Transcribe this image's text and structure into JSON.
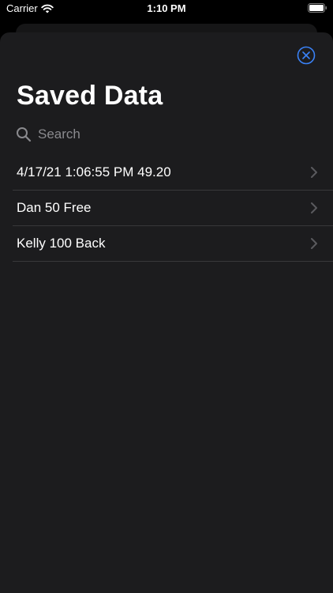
{
  "status_bar": {
    "carrier": "Carrier",
    "time": "1:10 PM"
  },
  "sheet": {
    "title": "Saved Data",
    "close_icon": "close-circle-icon",
    "accent_color": "#3a82f7"
  },
  "search": {
    "placeholder": "Search",
    "value": ""
  },
  "saved_items": [
    {
      "label": "4/17/21 1:06:55 PM 49.20"
    },
    {
      "label": "Dan 50 Free"
    },
    {
      "label": "Kelly 100 Back"
    }
  ]
}
